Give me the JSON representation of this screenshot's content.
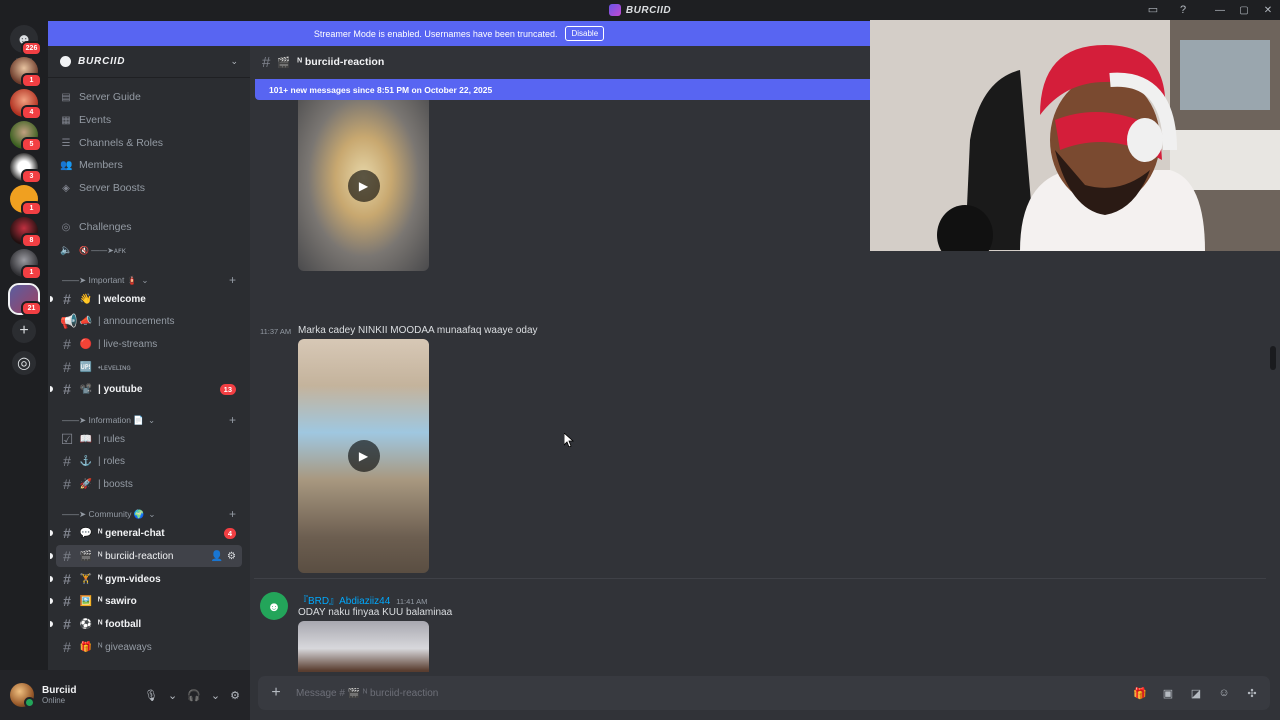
{
  "window": {
    "title": "BURCIID"
  },
  "rail": {
    "home_badge": "226",
    "servers": [
      {
        "badge": "1"
      },
      {
        "badge": "4"
      },
      {
        "badge": "5"
      },
      {
        "badge": "3"
      },
      {
        "badge": "1"
      },
      {
        "badge": "8"
      },
      {
        "badge": "1"
      },
      {
        "badge": "21"
      }
    ]
  },
  "banner": {
    "text": "Streamer Mode is enabled. Usernames have been truncated.",
    "button": "Disable"
  },
  "sidebar": {
    "server_name": "BURCIID",
    "nav": [
      {
        "label": "Server Guide",
        "icon": "book-icon"
      },
      {
        "label": "Events",
        "icon": "calendar-icon"
      },
      {
        "label": "Channels & Roles",
        "icon": "list-icon"
      },
      {
        "label": "Members",
        "icon": "members-icon"
      },
      {
        "label": "Server Boosts",
        "icon": "boost-icon"
      }
    ],
    "challenges": "Challenges",
    "afk": "🔇 ——➤ᴀꜰᴋ",
    "categories": {
      "important": "——➤ Important 🧯",
      "information": "——➤ Information 📄",
      "community": "——➤ Community 🌍"
    },
    "channels": {
      "welcome": {
        "emoji": "👋",
        "label": "| welcome"
      },
      "announcements": {
        "emoji": "📣",
        "label": "| announcements"
      },
      "live_streams": {
        "emoji": "🔴",
        "label": "| live-streams"
      },
      "leveling": {
        "emoji": "🆙",
        "label": "•ʟᴇᴠᴇʟɪɴɢ"
      },
      "youtube": {
        "emoji": "📽️",
        "label": "| youtube",
        "mentions": "13"
      },
      "rules": {
        "emoji": "📖",
        "label": "| rules"
      },
      "roles": {
        "emoji": "⚓",
        "label": "| roles"
      },
      "boosts": {
        "emoji": "🚀",
        "label": "| boosts"
      },
      "general_chat": {
        "emoji": "💬",
        "label": "ᴺ general-chat",
        "mentions": "4"
      },
      "burciid_reaction": {
        "emoji": "🎬",
        "label": "ᴺ burciid-reaction"
      },
      "gym_videos": {
        "emoji": "🏋️",
        "label": "ᴺ gym-videos"
      },
      "sawiro": {
        "emoji": "🖼️",
        "label": "ᴺ sawiro"
      },
      "football": {
        "emoji": "⚽",
        "label": "ᴺ football"
      },
      "giveaways": {
        "emoji": "🎁",
        "label": "ᴺ giveaways"
      }
    }
  },
  "user": {
    "name": "Burciid",
    "status": "Online"
  },
  "channel": {
    "name": "ᴺ burciid-reaction",
    "emoji": "🎬"
  },
  "newbar": "101+ new messages since 8:51 PM on October 22, 2025",
  "messages": [
    {
      "time": "11:37 AM",
      "text": "Marka cadey NINKII MOODAA munaafaq waaye oday"
    },
    {
      "author": "『BRD』Abdiaziiz44",
      "time": "11:41 AM",
      "text": "ODAY naku finyaa KUU balaminaa"
    }
  ],
  "composer": {
    "placeholder": "Message # 🎬 ᴺ burciid-reaction"
  },
  "colors": {
    "accent": "#5865f2",
    "mention": "#f23f43",
    "online": "#23a55a",
    "link": "#00a8fc"
  }
}
